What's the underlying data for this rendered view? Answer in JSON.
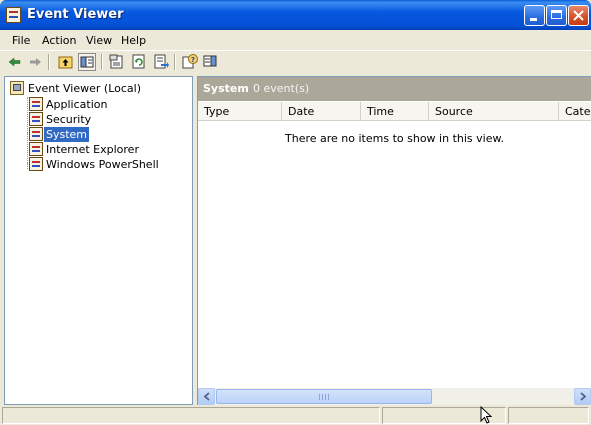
{
  "window": {
    "title": "Event Viewer"
  },
  "menu": {
    "items": [
      "File",
      "Action",
      "View",
      "Help"
    ]
  },
  "toolbar": {
    "buttons": [
      "back-arrow-icon",
      "forward-arrow-icon",
      "up-one-level-icon",
      "show-hide-tree-icon",
      "properties-icon",
      "refresh-icon",
      "export-list-icon",
      "help-icon",
      "show-hide-action-pane-icon"
    ]
  },
  "tree": {
    "root": "Event Viewer (Local)",
    "children": [
      {
        "label": "Application",
        "selected": false
      },
      {
        "label": "Security",
        "selected": false
      },
      {
        "label": "System",
        "selected": true
      },
      {
        "label": "Internet Explorer",
        "selected": false
      },
      {
        "label": "Windows PowerShell",
        "selected": false
      }
    ]
  },
  "list": {
    "title": "System",
    "count": "0 event(s)",
    "columns": [
      "Type",
      "Date",
      "Time",
      "Source",
      "Categ"
    ],
    "empty_message": "There are no items to show in this view."
  },
  "colors": {
    "title_bar": "#0451d6",
    "selection": "#316ac5",
    "header": "#aca899"
  }
}
